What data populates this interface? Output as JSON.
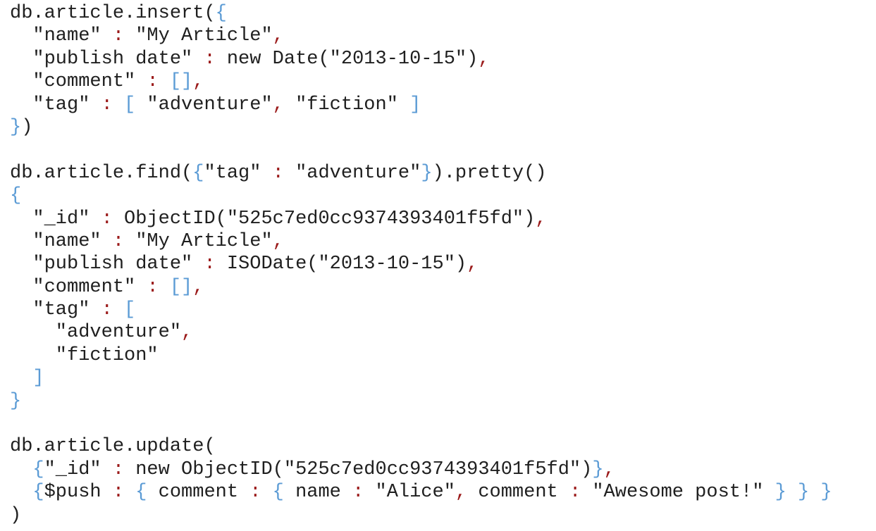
{
  "colors": {
    "text": "#1f1f1f",
    "punctuation": "#9b1b1b",
    "bracket": "#5b9bd5"
  },
  "code_lines": [
    [
      {
        "t": "db.article.insert(",
        "c": "text"
      },
      {
        "t": "{",
        "c": "bracket"
      }
    ],
    [
      {
        "t": "  \"name\" ",
        "c": "text"
      },
      {
        "t": ":",
        "c": "punct"
      },
      {
        "t": " \"My Article\"",
        "c": "text"
      },
      {
        "t": ",",
        "c": "punct"
      }
    ],
    [
      {
        "t": "  \"publish date\" ",
        "c": "text"
      },
      {
        "t": ":",
        "c": "punct"
      },
      {
        "t": " new Date(\"2013-10-15\")",
        "c": "text"
      },
      {
        "t": ",",
        "c": "punct"
      }
    ],
    [
      {
        "t": "  \"comment\" ",
        "c": "text"
      },
      {
        "t": ":",
        "c": "punct"
      },
      {
        "t": " ",
        "c": "text"
      },
      {
        "t": "[]",
        "c": "bracket"
      },
      {
        "t": ",",
        "c": "punct"
      }
    ],
    [
      {
        "t": "  \"tag\" ",
        "c": "text"
      },
      {
        "t": ":",
        "c": "punct"
      },
      {
        "t": " ",
        "c": "text"
      },
      {
        "t": "[",
        "c": "bracket"
      },
      {
        "t": " \"adventure\"",
        "c": "text"
      },
      {
        "t": ",",
        "c": "punct"
      },
      {
        "t": " \"fiction\" ",
        "c": "text"
      },
      {
        "t": "]",
        "c": "bracket"
      }
    ],
    [
      {
        "t": "}",
        "c": "bracket"
      },
      {
        "t": ")",
        "c": "text"
      }
    ],
    [],
    [
      {
        "t": "db.article.find(",
        "c": "text"
      },
      {
        "t": "{",
        "c": "bracket"
      },
      {
        "t": "\"tag\" ",
        "c": "text"
      },
      {
        "t": ":",
        "c": "punct"
      },
      {
        "t": " \"adventure\"",
        "c": "text"
      },
      {
        "t": "}",
        "c": "bracket"
      },
      {
        "t": ").pretty()",
        "c": "text"
      }
    ],
    [
      {
        "t": "{",
        "c": "bracket"
      }
    ],
    [
      {
        "t": "  \"_id\" ",
        "c": "text"
      },
      {
        "t": ":",
        "c": "punct"
      },
      {
        "t": " ObjectID(\"525c7ed0cc9374393401f5fd\")",
        "c": "text"
      },
      {
        "t": ",",
        "c": "punct"
      }
    ],
    [
      {
        "t": "  \"name\" ",
        "c": "text"
      },
      {
        "t": ":",
        "c": "punct"
      },
      {
        "t": " \"My Article\"",
        "c": "text"
      },
      {
        "t": ",",
        "c": "punct"
      }
    ],
    [
      {
        "t": "  \"publish date\" ",
        "c": "text"
      },
      {
        "t": ":",
        "c": "punct"
      },
      {
        "t": " ISODate(\"2013-10-15\")",
        "c": "text"
      },
      {
        "t": ",",
        "c": "punct"
      }
    ],
    [
      {
        "t": "  \"comment\" ",
        "c": "text"
      },
      {
        "t": ":",
        "c": "punct"
      },
      {
        "t": " ",
        "c": "text"
      },
      {
        "t": "[]",
        "c": "bracket"
      },
      {
        "t": ",",
        "c": "punct"
      }
    ],
    [
      {
        "t": "  \"tag\" ",
        "c": "text"
      },
      {
        "t": ":",
        "c": "punct"
      },
      {
        "t": " ",
        "c": "text"
      },
      {
        "t": "[",
        "c": "bracket"
      }
    ],
    [
      {
        "t": "    \"adventure\"",
        "c": "text"
      },
      {
        "t": ",",
        "c": "punct"
      }
    ],
    [
      {
        "t": "    \"fiction\"",
        "c": "text"
      }
    ],
    [
      {
        "t": "  ",
        "c": "text"
      },
      {
        "t": "]",
        "c": "bracket"
      }
    ],
    [
      {
        "t": "}",
        "c": "bracket"
      }
    ],
    [],
    [
      {
        "t": "db.article.update(",
        "c": "text"
      }
    ],
    [
      {
        "t": "  ",
        "c": "text"
      },
      {
        "t": "{",
        "c": "bracket"
      },
      {
        "t": "\"_id\" ",
        "c": "text"
      },
      {
        "t": ":",
        "c": "punct"
      },
      {
        "t": " new ObjectID(\"525c7ed0cc9374393401f5fd\")",
        "c": "text"
      },
      {
        "t": "}",
        "c": "bracket"
      },
      {
        "t": ",",
        "c": "punct"
      }
    ],
    [
      {
        "t": "  ",
        "c": "text"
      },
      {
        "t": "{",
        "c": "bracket"
      },
      {
        "t": "$push ",
        "c": "text"
      },
      {
        "t": ":",
        "c": "punct"
      },
      {
        "t": " ",
        "c": "text"
      },
      {
        "t": "{",
        "c": "bracket"
      },
      {
        "t": " comment ",
        "c": "text"
      },
      {
        "t": ":",
        "c": "punct"
      },
      {
        "t": " ",
        "c": "text"
      },
      {
        "t": "{",
        "c": "bracket"
      },
      {
        "t": " name ",
        "c": "text"
      },
      {
        "t": ":",
        "c": "punct"
      },
      {
        "t": " \"Alice\"",
        "c": "text"
      },
      {
        "t": ",",
        "c": "punct"
      },
      {
        "t": " comment ",
        "c": "text"
      },
      {
        "t": ":",
        "c": "punct"
      },
      {
        "t": " \"Awesome post!\" ",
        "c": "text"
      },
      {
        "t": "}",
        "c": "bracket"
      },
      {
        "t": " ",
        "c": "text"
      },
      {
        "t": "}",
        "c": "bracket"
      },
      {
        "t": " ",
        "c": "text"
      },
      {
        "t": "}",
        "c": "bracket"
      }
    ],
    [
      {
        "t": ")",
        "c": "text"
      }
    ]
  ]
}
